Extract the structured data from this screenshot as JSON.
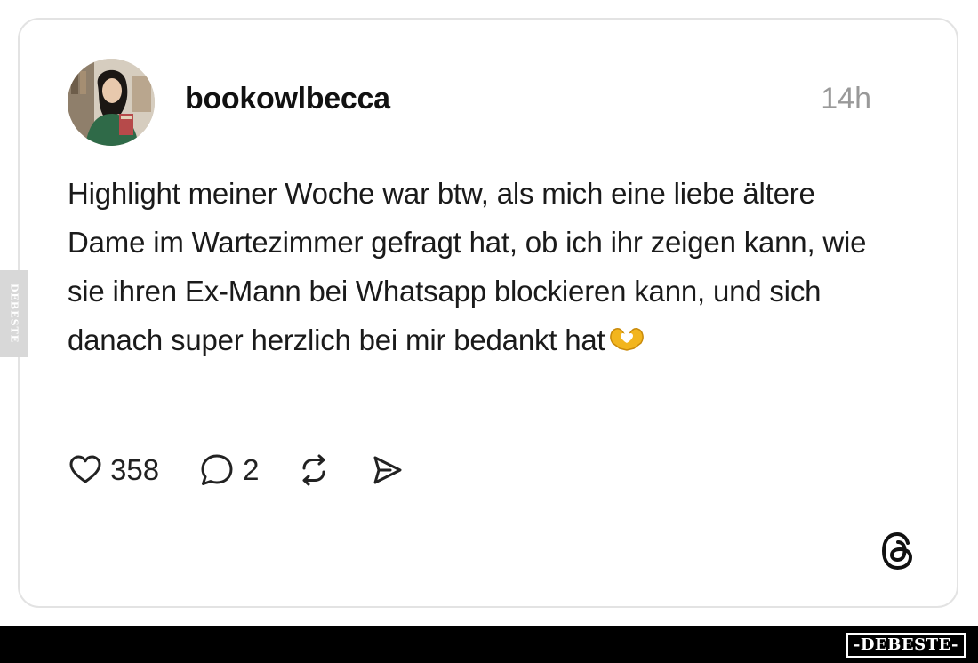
{
  "post": {
    "username": "bookowlbecca",
    "timestamp": "14h",
    "text": "Highlight meiner Woche war btw, als mich eine liebe ältere Dame im Wartezimmer gefragt hat, ob ich ihr zeigen kann, wie sie ihren Ex-Mann bei Whatsapp blockieren kann, und sich danach super herzlich bei mir bedankt hat",
    "text_emoji": "heart-hands-emoji"
  },
  "actions": {
    "likes": "358",
    "replies": "2",
    "like_icon": "heart-icon",
    "reply_icon": "comment-bubble-icon",
    "repost_icon": "repost-icon",
    "share_icon": "send-icon"
  },
  "branding": {
    "app_logo": "threads-logo-icon",
    "watermark_side": "DEBESTE",
    "watermark_bottom": "-DEBESTE-"
  },
  "colors": {
    "card_border": "#e3e3e3",
    "timestamp": "#999999",
    "emoji": "#f2b51e",
    "bottom_bar": "#000000"
  }
}
